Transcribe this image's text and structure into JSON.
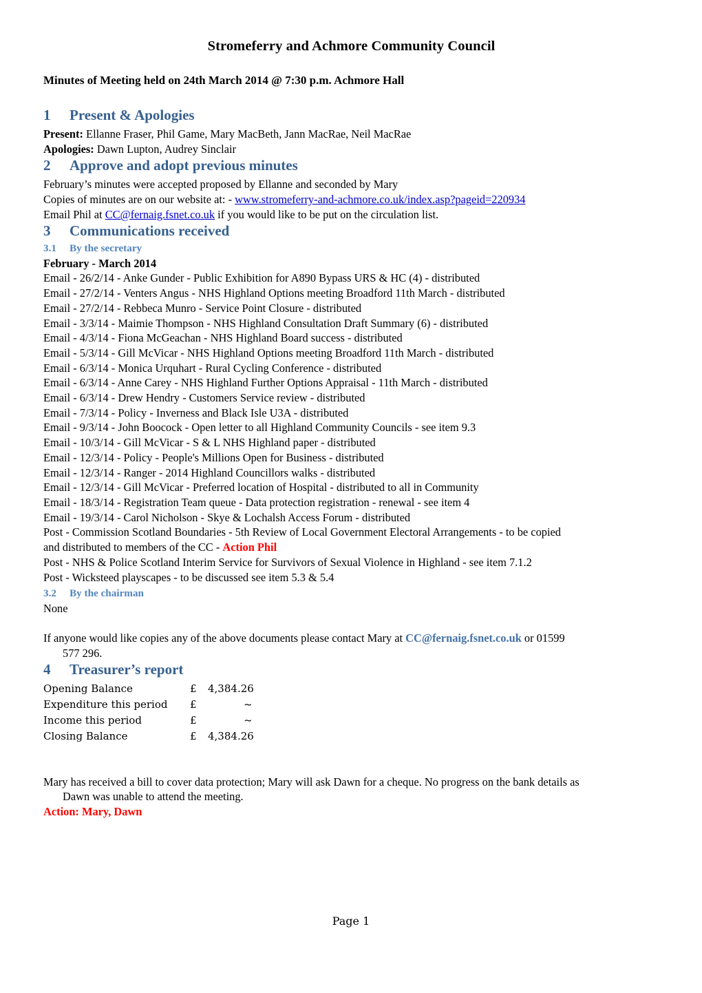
{
  "document": {
    "title": "Stromeferry and Achmore Community Council",
    "subtitle": "Minutes of Meeting held on 24th March 2014 @ 7:30 p.m. Achmore Hall",
    "footer": "Page 1"
  },
  "colors": {
    "heading1": "#36608F",
    "heading2": "#5285BE",
    "hyperlink": "#0000CC",
    "email_bold": "#4472A8",
    "action_red": "#FF0000"
  },
  "sections": {
    "present": {
      "number": "1",
      "title": "Present & Apologies",
      "present_label": "Present:",
      "present_value": " Ellanne Fraser, Phil Game, Mary MacBeth, Jann MacRae, Neil MacRae",
      "apologies_label": "Apologies:",
      "apologies_value": " Dawn Lupton, Audrey Sinclair"
    },
    "approve": {
      "number": "2",
      "title": "Approve and adopt previous minutes",
      "line1": "February’s minutes were accepted proposed by Ellanne and seconded by Mary",
      "line2_prefix": "Copies of minutes are on our website at: - ",
      "line2_link": "www.stromeferry-and-achmore.co.uk/index.asp?pageid=220934",
      "line3_prefix": "Email Phil at ",
      "line3_link": "CC@fernaig.fsnet.co.uk",
      "line3_suffix": " if you would like to be put on the circulation list."
    },
    "communications": {
      "number": "3",
      "title": "Communications received",
      "sub_secretary": {
        "number": "3.1",
        "title": "By the secretary",
        "period": "February - March 2014",
        "items": [
          "Email - 26/2/14 - Anke Gunder - Public Exhibition for A890 Bypass URS & HC (4) - distributed",
          "Email - 27/2/14 - Venters Angus - NHS Highland Options meeting Broadford 11th March - distributed",
          "Email - 27/2/14 - Rebbeca Munro - Service Point Closure - distributed",
          "Email - 3/3/14 - Maimie Thompson - NHS Highland Consultation Draft Summary (6) - distributed",
          "Email - 4/3/14 - Fiona McGeachan - NHS Highland Board success - distributed",
          "Email - 5/3/14 - Gill McVicar - NHS Highland Options meeting Broadford 11th March - distributed",
          "Email - 6/3/14 - Monica Urquhart - Rural Cycling Conference - distributed",
          "Email - 6/3/14 - Anne Carey - NHS Highland Further Options Appraisal - 11th March - distributed",
          "Email - 6/3/14 - Drew Hendry - Customers Service review - distributed",
          "Email - 7/3/14 - Policy - Inverness and Black Isle U3A - distributed",
          "Email - 9/3/14 - John Boocock - Open letter to all Highland Community Councils - see item 9.3",
          "Email - 10/3/14 - Gill McVicar - S & L NHS Highland paper - distributed",
          "Email - 12/3/14 - Policy - People's Millions Open for Business - distributed",
          "Email - 12/3/14 - Ranger - 2014 Highland Councillors walks - distributed",
          "Email - 12/3/14 - Gill McVicar - Preferred location of Hospital - distributed to all in Community",
          "Email - 18/3/14 - Registration Team queue - Data protection registration - renewal - see item 4",
          "Email - 19/3/14 - Carol Nicholson - Skye & Lochalsh Access Forum - distributed"
        ],
        "post_wrapped": {
          "part1": "Post - Commission Scotland Boundaries - 5th Review of Local Government Electoral Arrangements - to be copied",
          "part2": "and distributed to members of the CC - ",
          "action": "Action Phil"
        },
        "post_items": [
          "Post - NHS & Police Scotland Interim Service for Survivors of Sexual Violence in Highland - see item 7.1.2",
          "Post - Wicksteed playscapes - to be discussed see item 5.3 & 5.4"
        ]
      },
      "sub_chairman": {
        "number": "3.2",
        "title": "By the chairman",
        "content": "None"
      },
      "contact_note": {
        "prefix": "If anyone would like copies any of the above documents please contact Mary at ",
        "email": "CC@fernaig.fsnet.co.uk",
        "suffix": " or 01599",
        "continuation": "577 296."
      }
    },
    "treasurer": {
      "number": "4",
      "title": "Treasurer’s report",
      "table": {
        "rows": [
          {
            "label": "Opening Balance",
            "currency": "£",
            "value": "4,384.26"
          },
          {
            "label": "Expenditure this period",
            "currency": "£",
            "value": "~"
          },
          {
            "label": "Income this period",
            "currency": "£",
            "value": "~"
          },
          {
            "label": "Closing Balance",
            "currency": "£",
            "value": "4,384.26"
          }
        ]
      },
      "note_line1": "Mary has received a bill to cover data protection; Mary will ask Dawn for a cheque. No progress on the bank details as",
      "note_line2": "Dawn was unable to attend the meeting.",
      "action": "Action: Mary, Dawn"
    }
  }
}
